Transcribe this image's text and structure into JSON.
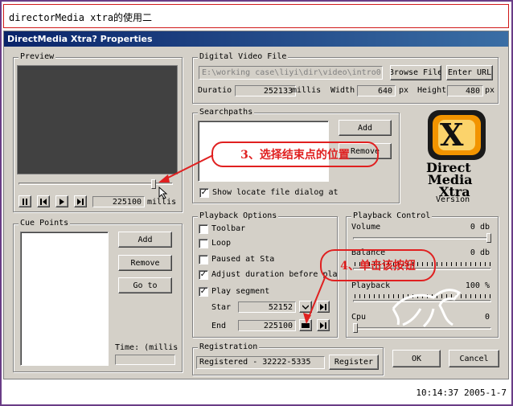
{
  "caption": "directorMedia xtra的使用二",
  "window_title": "DirectMedia Xtra? Properties",
  "preview": {
    "label": "Preview",
    "position_value": "225100",
    "unit": "millis"
  },
  "digital_video": {
    "label": "Digital Video File",
    "path": "E:\\working case\\liyi\\dir\\video\\intro0",
    "browse_label": "Browse File",
    "enter_url_label": "Enter URL",
    "duration_label": "Duratio",
    "duration_value": "252133",
    "duration_unit": "millis",
    "width_label": "Width",
    "width_value": "640",
    "width_unit": "px",
    "height_label": "Height",
    "height_value": "480",
    "height_unit": "px"
  },
  "searchpaths": {
    "label": "Searchpaths",
    "add_label": "Add",
    "remove_label": "Remove",
    "show_dialog_label": "Show locate file dialog at"
  },
  "logo": {
    "letter": "X",
    "line1": "Direct",
    "line2": "Media",
    "line3": "Xtra",
    "version_label": "Version"
  },
  "cue_points": {
    "label": "Cue Points",
    "add_label": "Add",
    "remove_label": "Remove",
    "goto_label": "Go to",
    "time_label": "Time: (millis"
  },
  "playback_options": {
    "label": "Playback Options",
    "toolbar_label": "Toolbar",
    "loop_label": "Loop",
    "paused_label": "Paused at Sta",
    "adjust_label": "Adjust duration before pla",
    "play_segment_label": "Play segment",
    "start_label": "Star",
    "start_value": "52152",
    "end_label": "End",
    "end_value": "225100",
    "toolbar_checked": false,
    "loop_checked": false,
    "paused_checked": false,
    "adjust_checked": true,
    "play_segment_checked": true,
    "show_dialog_checked": true
  },
  "playback_control": {
    "label": "Playback Control",
    "volume_label": "Volume",
    "volume_value": "0 db",
    "balance_label": "Balance",
    "balance_value": "0 db",
    "playback_label": "Playback",
    "playback_value": "100 %",
    "cpu_label": "Cpu",
    "cpu_value": "0"
  },
  "registration": {
    "label": "Registration",
    "value": "Registered - 32222-5335",
    "register_label": "Register"
  },
  "dialog_buttons": {
    "ok_label": "OK",
    "cancel_label": "Cancel"
  },
  "annotations": {
    "step3": "3、选择结束点的位置",
    "step4": "4、单击该按钮"
  },
  "timestamp": "10:14:37 2005-1-7",
  "colors": {
    "annotation": "#e02020",
    "titlebar": "#0a246a",
    "logo_orange": "#f29400"
  }
}
